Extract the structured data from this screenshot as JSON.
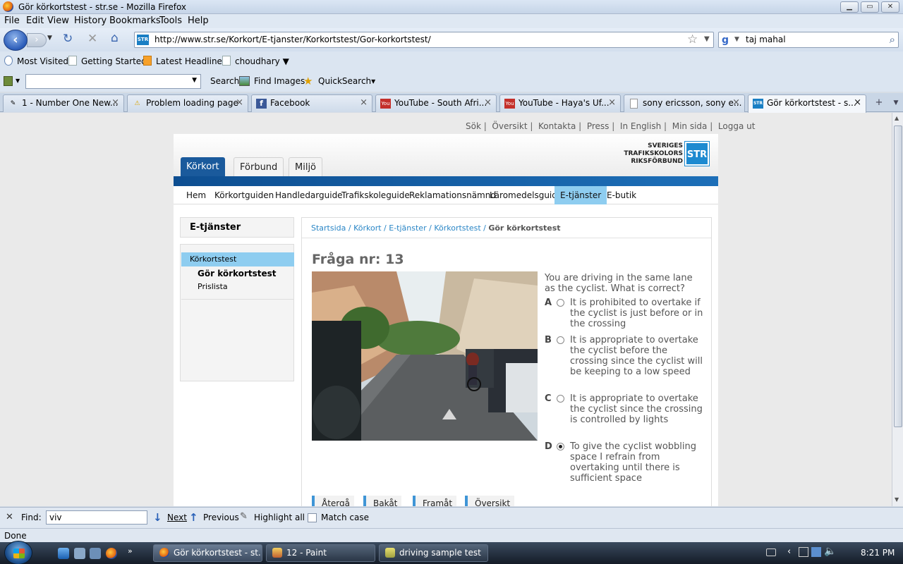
{
  "window": {
    "title": "Gör körkortstest - str.se - Mozilla Firefox",
    "minimize_label": "▁",
    "maximize_label": "▭",
    "close_label": "✕"
  },
  "menu": [
    "File",
    "Edit",
    "View",
    "History",
    "Bookmarks",
    "Tools",
    "Help"
  ],
  "nav": {
    "url": "http://www.str.se/Korkort/E-tjanster/Korkortstest/Gor-korkortstest/",
    "site_badge": "STR",
    "search_value": "taj mahal"
  },
  "bookmarks": [
    "Most Visited",
    "Getting Started",
    "Latest Headlines",
    "choudhary ▼"
  ],
  "toolbar2": {
    "search_label": "Search",
    "find_images_label": "Find Images",
    "quicksearch_label": "QuickSearch▾"
  },
  "tabs": [
    {
      "label": "1 - Number One New...",
      "icon": "generic-site-icon"
    },
    {
      "label": "Problem loading page",
      "icon": "warning-icon"
    },
    {
      "label": "Facebook",
      "icon": "facebook-icon"
    },
    {
      "label": "YouTube - South Afri...",
      "icon": "youtube-icon"
    },
    {
      "label": "YouTube - Haya's Uf...",
      "icon": "youtube-icon"
    },
    {
      "label": "sony ericsson, sony e...",
      "icon": "blank-page-icon"
    },
    {
      "label": "Gör körkortstest - s...",
      "icon": "str-icon",
      "active": true
    }
  ],
  "site": {
    "top_links": [
      "Sök",
      "Översikt",
      "Kontakta",
      "Press",
      "In English",
      "Min sida",
      "Logga ut"
    ],
    "main_tabs": [
      "Körkort",
      "Förbund",
      "Miljö"
    ],
    "logo_text": [
      "SVERIGES",
      "TRAFIKSKOLORS",
      "RIKSFÖRBUND"
    ],
    "logo_badge": "STR",
    "subnav": [
      "Hem",
      "Körkortguiden",
      "Handledarguide",
      "Trafikskoleguide",
      "Reklamationsnämnd",
      "Läromedelsguide",
      "E-tjänster",
      "E-butik"
    ],
    "subnav_active": "E-tjänster",
    "left_heading": "E-tjänster",
    "left_selected": "Körkortstest",
    "left_items": [
      "Gör körkortstest",
      "Prislista"
    ],
    "breadcrumb": [
      "Startsida",
      "Körkort",
      "E-tjänster",
      "Körkortstest"
    ],
    "breadcrumb_current": "Gör körkortstest",
    "question_title": "Fråga nr: 13",
    "question_text": "You are driving in the same lane as the cyclist. What is correct?",
    "options": [
      {
        "letter": "A",
        "text": "It is prohibited to overtake if the cyclist is just before or in the crossing",
        "checked": false
      },
      {
        "letter": "B",
        "text": "It is appropriate to overtake the cyclist before the crossing since the cyclist will be keeping to a low speed",
        "checked": false
      },
      {
        "letter": "C",
        "text": "It is appropriate to overtake the cyclist since the crossing is controlled by lights",
        "checked": false
      },
      {
        "letter": "D",
        "text": "To give the cyclist wobbling space I refrain from overtaking until there is sufficient space",
        "checked": true
      }
    ],
    "buttons": [
      "Återgå",
      "Bakåt",
      "Framåt",
      "Översikt"
    ]
  },
  "findbar": {
    "label": "Find:",
    "value": "viv",
    "next": "Next",
    "previous": "Previous",
    "highlight": "Highlight all",
    "match_case": "Match case"
  },
  "status": "Done",
  "taskbar": {
    "items": [
      {
        "label": "Gör körkortstest - st...",
        "active": true
      },
      {
        "label": "12 - Paint",
        "active": false
      },
      {
        "label": "driving sample test",
        "active": false
      }
    ],
    "clock": "8:21 PM"
  }
}
